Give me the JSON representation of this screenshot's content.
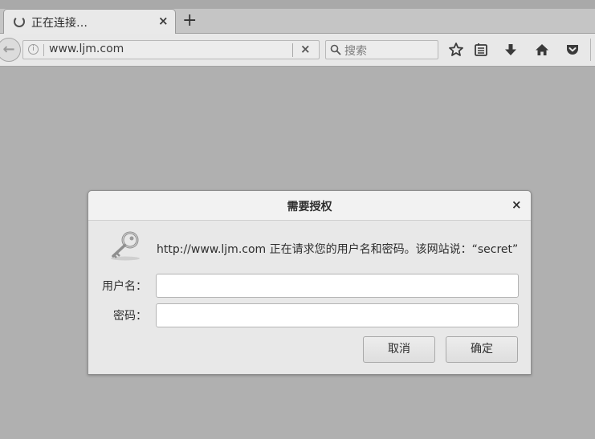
{
  "tab": {
    "title": "正在连接…",
    "close": "×",
    "new_tab": "+"
  },
  "navbar": {
    "back": "←",
    "info": "i",
    "url": "www.ljm.com",
    "clear": "×",
    "search_placeholder": "搜索",
    "icons": [
      "star-icon",
      "reader-list-icon",
      "download-icon",
      "home-icon",
      "pocket-icon"
    ]
  },
  "dialog": {
    "title": "需要授权",
    "close": "×",
    "message": "http://www.ljm.com 正在请求您的用户名和密码。该网站说：“secret”",
    "username_label": "用户名：",
    "username_value": "",
    "password_label": "密码：",
    "password_value": "",
    "cancel_label": "取消",
    "ok_label": "确定"
  },
  "colors": {
    "background": "#b0b0b0",
    "toolbar": "#e8e8e8",
    "dialog": "#e8e8e8"
  }
}
